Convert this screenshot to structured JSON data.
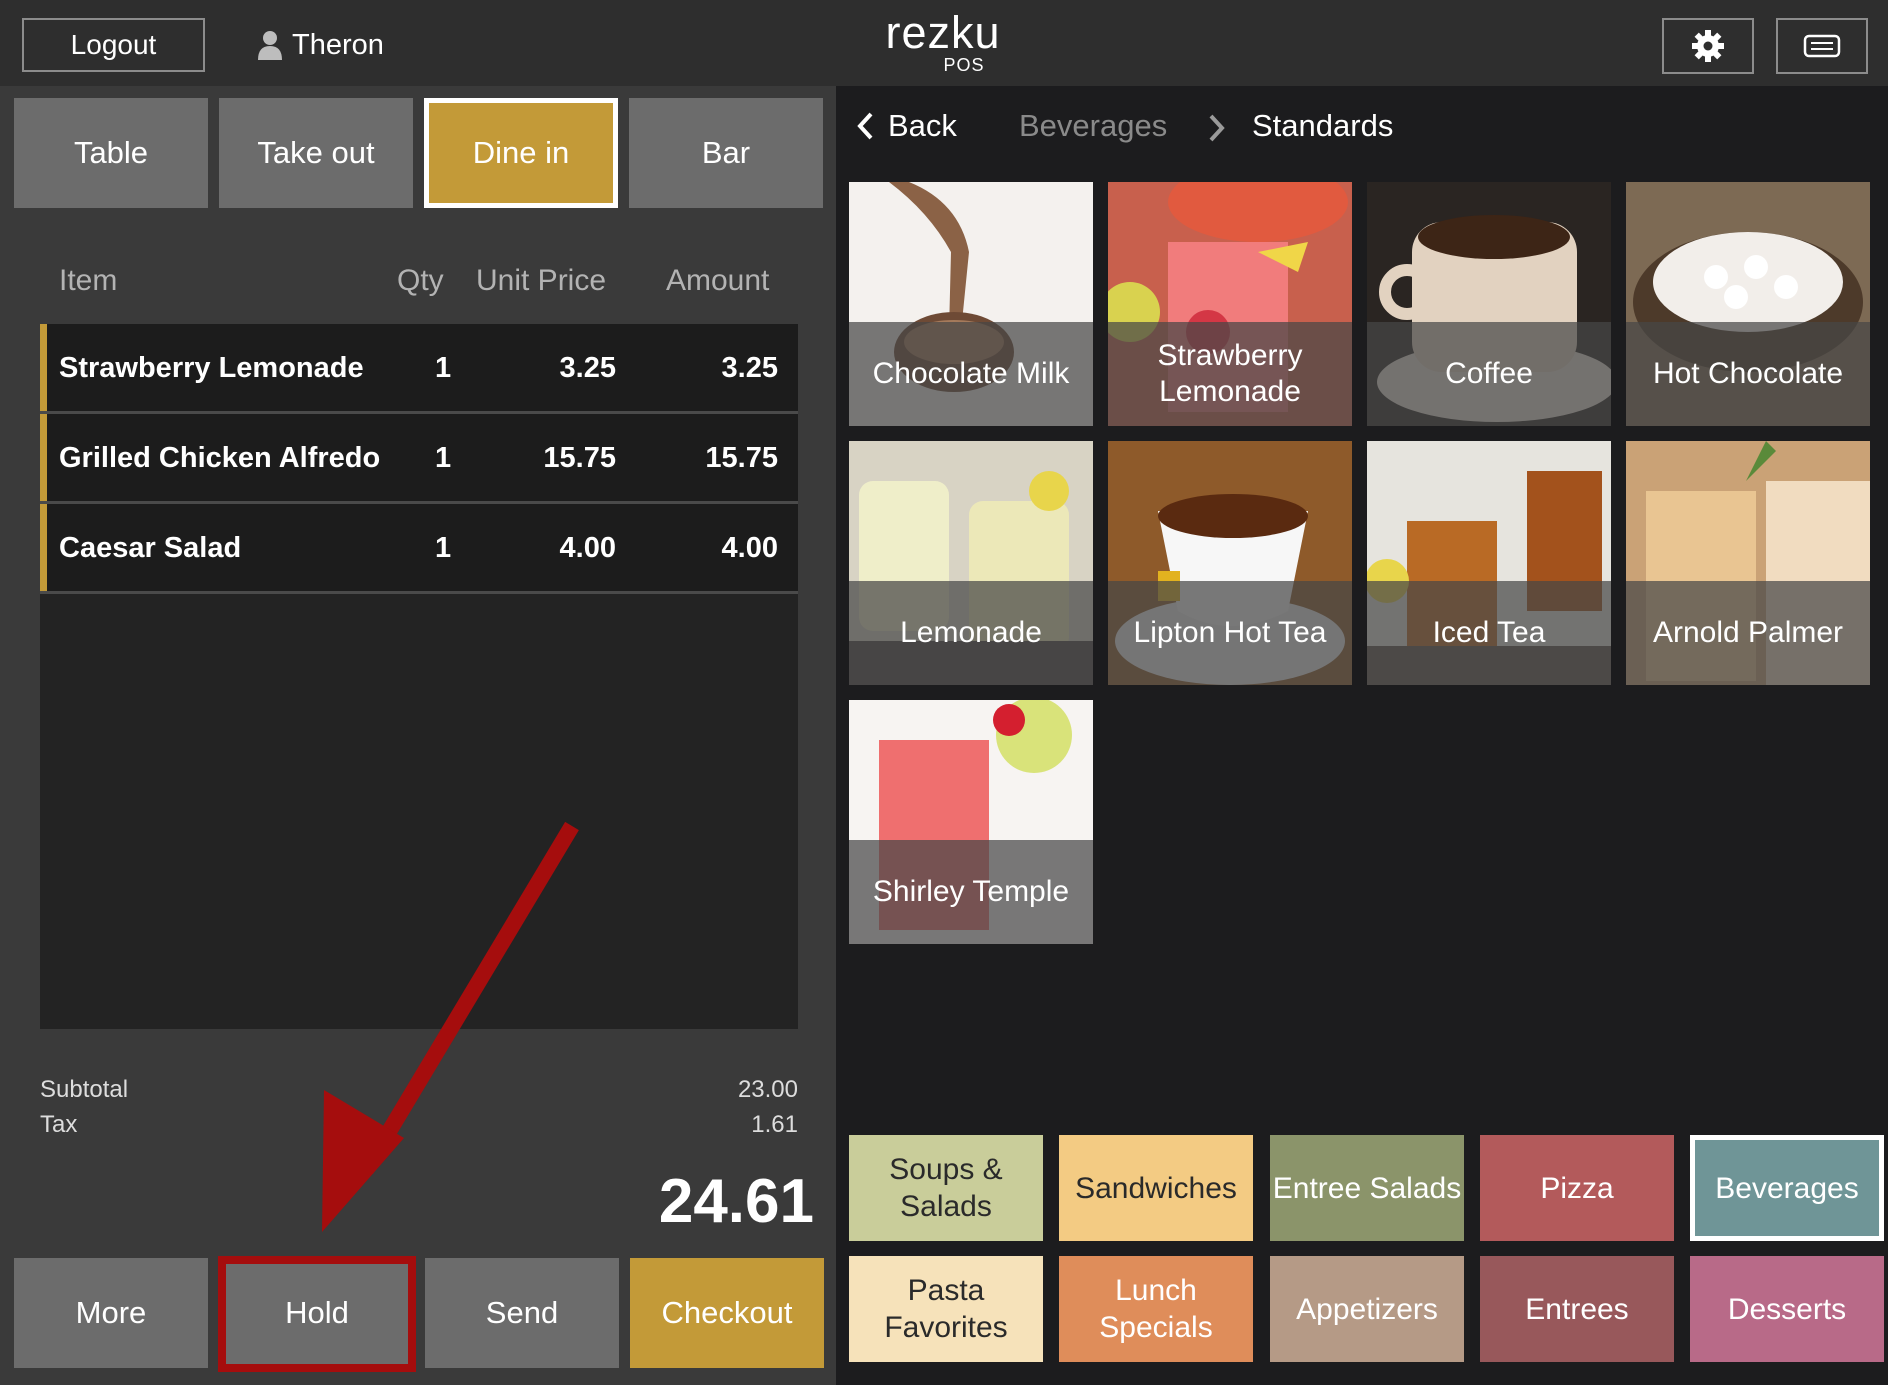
{
  "header": {
    "logout_label": "Logout",
    "user_name": "Theron",
    "brand_logo": "rezku",
    "brand_sub": "POS",
    "settings_icon": "gear-icon",
    "drawer_icon": "cash-drawer-icon"
  },
  "order_types": [
    {
      "label": "Table",
      "active": false
    },
    {
      "label": "Take out",
      "active": false
    },
    {
      "label": "Dine in",
      "active": true
    },
    {
      "label": "Bar",
      "active": false
    }
  ],
  "order_table": {
    "columns": [
      "Item",
      "Qty",
      "Unit Price",
      "Amount"
    ],
    "rows": [
      {
        "item": "Strawberry Lemonade",
        "qty": "1",
        "unit_price": "3.25",
        "amount": "3.25"
      },
      {
        "item": "Grilled Chicken Alfredo",
        "qty": "1",
        "unit_price": "15.75",
        "amount": "15.75"
      },
      {
        "item": "Caesar Salad",
        "qty": "1",
        "unit_price": "4.00",
        "amount": "4.00"
      }
    ]
  },
  "totals": {
    "subtotal_label": "Subtotal",
    "subtotal": "23.00",
    "tax_label": "Tax",
    "tax": "1.61",
    "total": "24.61"
  },
  "actions": {
    "more": "More",
    "hold": "Hold",
    "send": "Send",
    "checkout": "Checkout"
  },
  "breadcrumb": {
    "back": "Back",
    "parent": "Beverages",
    "current": "Standards"
  },
  "menu_items": [
    {
      "label": "Chocolate Milk"
    },
    {
      "label": "Strawberry Lemonade"
    },
    {
      "label": "Coffee"
    },
    {
      "label": "Hot Chocolate"
    },
    {
      "label": "Lemonade"
    },
    {
      "label": "Lipton Hot Tea"
    },
    {
      "label": "Iced Tea"
    },
    {
      "label": "Arnold Palmer"
    },
    {
      "label": "Shirley Temple"
    }
  ],
  "categories": [
    {
      "label": "Soups & Salads",
      "color": "#c9cd9a"
    },
    {
      "label": "Sandwiches",
      "color": "#f3cb83"
    },
    {
      "label": "Entree Salads",
      "color": "#8b946a"
    },
    {
      "label": "Pizza",
      "color": "#b35a5b"
    },
    {
      "label": "Beverages",
      "color": "#6f9597"
    },
    {
      "label": "Pasta Favorites",
      "color": "#f6e2ba"
    },
    {
      "label": "Lunch Specials",
      "color": "#df8d5a"
    },
    {
      "label": "Appetizers",
      "color": "#b59a86"
    },
    {
      "label": "Entrees",
      "color": "#98585b"
    },
    {
      "label": "Desserts",
      "color": "#b86a88"
    }
  ],
  "accent_color": "#c39a38",
  "annotation_color": "#a50d0d"
}
